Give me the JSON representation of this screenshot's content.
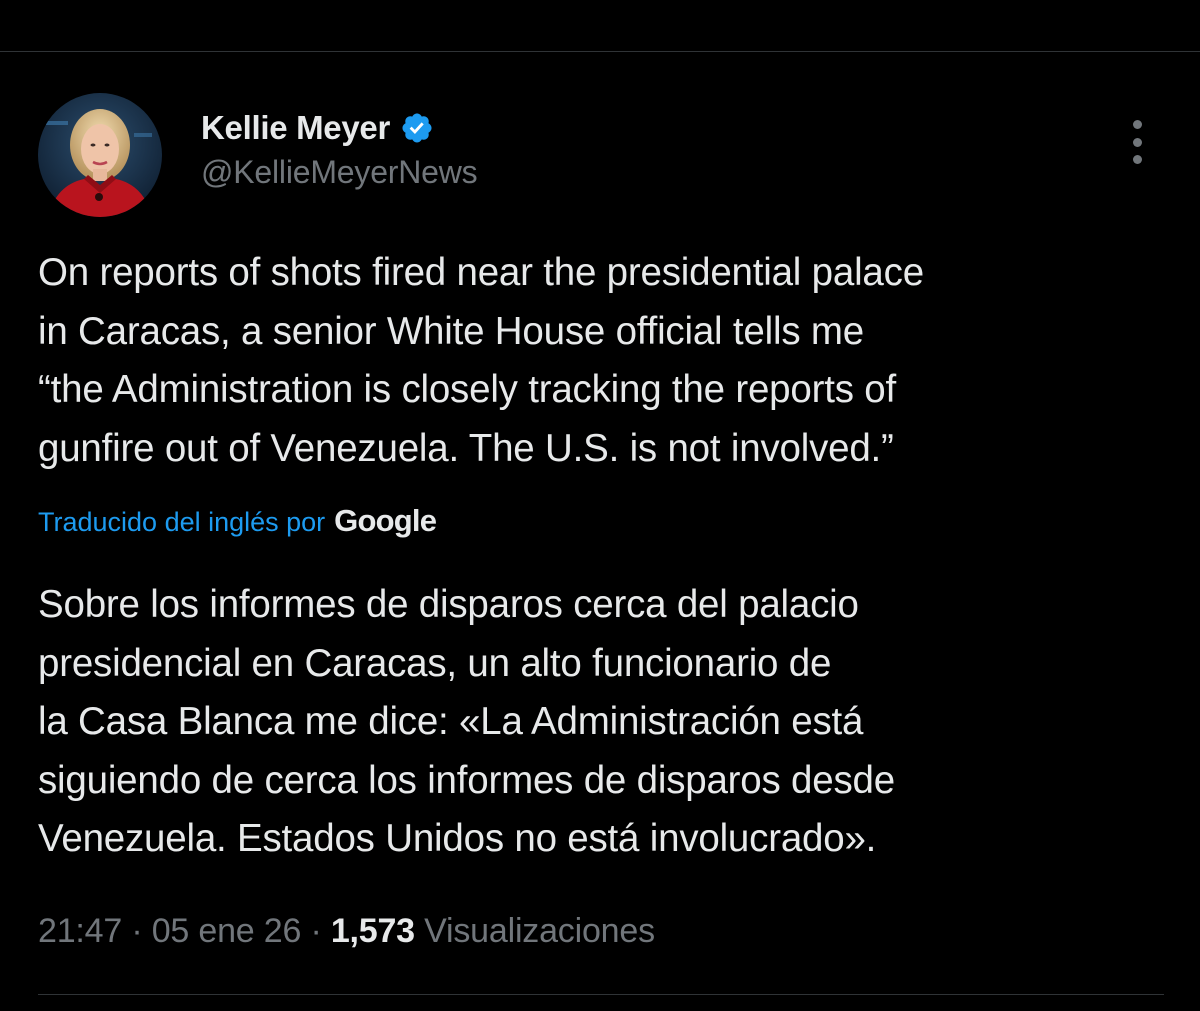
{
  "tweet": {
    "author": {
      "display_name": "Kellie Meyer",
      "handle": "@KellieMeyerNews",
      "verified": true,
      "verified_color": "#1d9bf0"
    },
    "original_text": "On reports of shots fired near the presidential palace\nin Caracas, a senior White House official tells me\n“the Administration is closely tracking the reports of\ngunfire out of Venezuela. The U.S. is not involved.”",
    "translation": {
      "label": "Traducido del inglés por",
      "provider": "Google"
    },
    "translated_text": "Sobre los informes de disparos cerca del palacio\npresidencial en Caracas, un alto funcionario de\nla Casa Blanca me dice: «La Administración está\nsiguiendo de cerca los informes de disparos desde\nVenezuela. Estados Unidos no está involucrado».",
    "meta": {
      "time": "21:47",
      "separator": "·",
      "date": "05 ene 26",
      "views_count": "1,573",
      "views_label": "Visualizaciones"
    }
  },
  "icons": {
    "more": "more-vertical-icon",
    "verified": "verified-badge-icon"
  },
  "colors": {
    "background": "#000000",
    "text_primary": "#e7e9ea",
    "text_secondary": "#71767b",
    "accent": "#1d9bf0",
    "divider": "#2f3336"
  }
}
